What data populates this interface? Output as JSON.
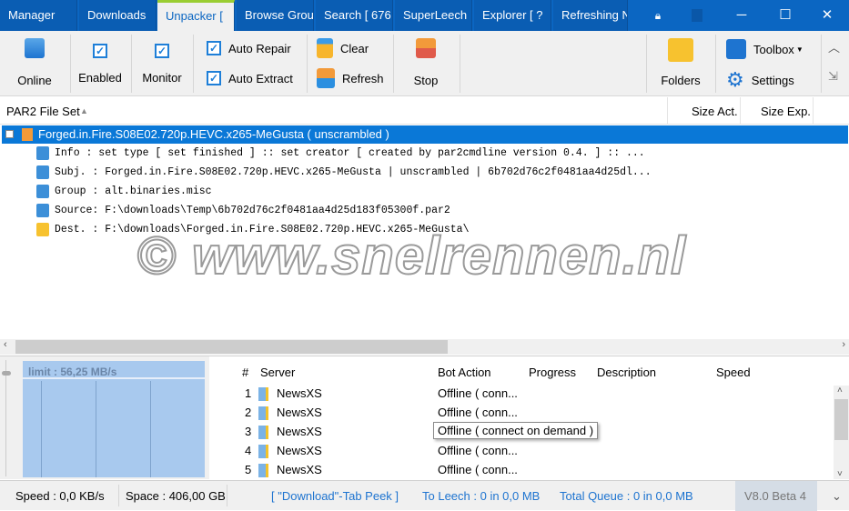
{
  "tabs": [
    {
      "label": "Manager"
    },
    {
      "label": "Downloads"
    },
    {
      "label": "Unpacker ["
    },
    {
      "label": "Browse Grou"
    },
    {
      "label": "Search [ 676"
    },
    {
      "label": "SuperLeech"
    },
    {
      "label": "Explorer [ ?"
    },
    {
      "label": "Refreshing N"
    }
  ],
  "window": {
    "minimize": "─",
    "maximize": "☐",
    "close": "✕"
  },
  "ribbon": {
    "online": "Online",
    "enabled": "Enabled",
    "monitor": "Monitor",
    "auto_repair": "Auto Repair",
    "auto_extract": "Auto Extract",
    "clear": "Clear",
    "refresh": "Refresh",
    "stop": "Stop",
    "folders": "Folders",
    "toolbox": "Toolbox",
    "settings": "Settings"
  },
  "columns": {
    "file_set": "PAR2 File Set",
    "size_act": "Size Act.",
    "size_exp": "Size Exp."
  },
  "tree": {
    "root": "Forged.in.Fire.S08E02.720p.HEVC.x265-MeGusta    ( unscrambled )",
    "leaves": [
      {
        "text": "Info  : set type [ set finished ] :: set creator [ created by par2cmdline version 0.4. ] :: ..."
      },
      {
        "text": "Subj. : Forged.in.Fire.S08E02.720p.HEVC.x265-MeGusta | unscrambled | 6b702d76c2f0481aa4d25dl..."
      },
      {
        "text": "Group : alt.binaries.misc"
      },
      {
        "text": "Source: F:\\downloads\\Temp\\6b702d76c2f0481aa4d25d183f05300f.par2"
      },
      {
        "text": "Dest. : F:\\downloads\\Forged.in.Fire.S08E02.720p.HEVC.x265-MeGusta\\"
      }
    ]
  },
  "watermark": "© www.snelrennen.nl",
  "graph": {
    "limit": "limit : 56,25 MB/s"
  },
  "servers": {
    "headers": {
      "num": "#",
      "server": "Server",
      "bot_action": "Bot Action",
      "progress": "Progress",
      "description": "Description",
      "speed": "Speed"
    },
    "rows": [
      {
        "num": "1",
        "server": "NewsXS",
        "action": "Offline ( conn..."
      },
      {
        "num": "2",
        "server": "NewsXS",
        "action": "Offline ( conn..."
      },
      {
        "num": "3",
        "server": "NewsXS",
        "action": ""
      },
      {
        "num": "4",
        "server": "NewsXS",
        "action": "Offline ( conn..."
      },
      {
        "num": "5",
        "server": "NewsXS",
        "action": "Offline ( conn..."
      }
    ],
    "tooltip": "Offline ( connect on demand )"
  },
  "status": {
    "speed": "Speed : 0,0 KB/s",
    "space": "Space : 406,00 GB",
    "peek": "[ \"Download\"-Tab Peek ]",
    "to_leech": "To Leech : 0 in 0,0 MB",
    "total_queue": "Total Queue : 0 in 0,0 MB",
    "version": "V8.0 Beta 4"
  }
}
